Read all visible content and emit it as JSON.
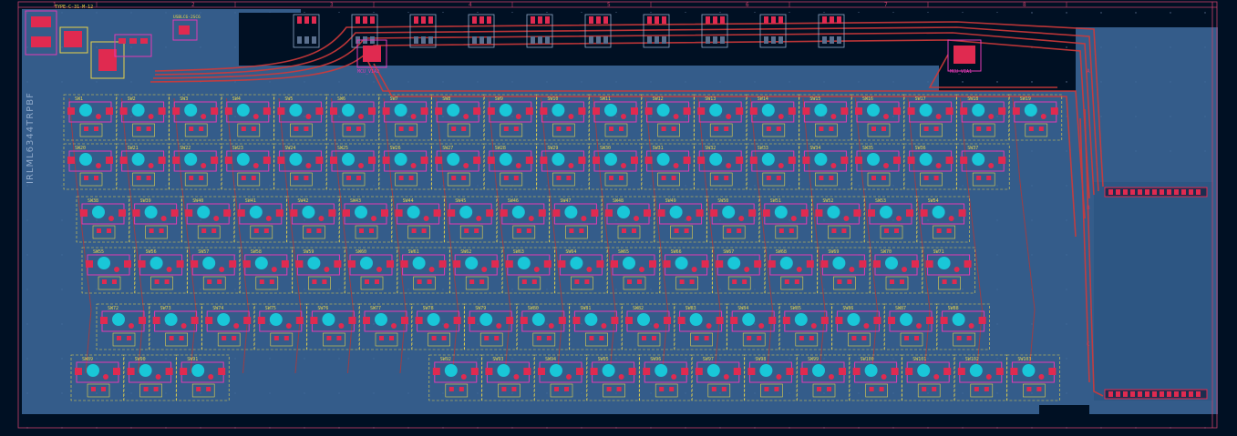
{
  "board": {
    "ruler_numbers": [
      "1",
      "2",
      "3",
      "4",
      "5",
      "6",
      "7",
      "8"
    ],
    "ruler_letters": [
      "A",
      "B",
      "C"
    ],
    "side_label": "IRLML6344TRPBF",
    "top_labels": [
      "TYPE-C-31-M-12",
      "USBLC6-2SC6"
    ],
    "mcu_labels": [
      "MCU_VIA2",
      "MCU_VIA1"
    ],
    "colors": {
      "background": "#001023",
      "copper_fill": "#3d6a9c",
      "trace_red": "#d03a3a",
      "silk_yellow": "#e7d24a",
      "courtyard_pink": "#e23ab4",
      "pad_red": "#e02a50",
      "hole_cyan": "#19c7d8"
    }
  },
  "rows": [
    {
      "labels": [
        "SW1",
        "SW2",
        "SW3",
        "SW4",
        "SW5",
        "SW6",
        "SW7",
        "SW8",
        "SW9",
        "SW10",
        "SW11",
        "SW12",
        "SW13",
        "SW14",
        "SW15",
        "SW16",
        "SW17",
        "SW18",
        "SW19"
      ]
    },
    {
      "labels": [
        "SW20",
        "SW21",
        "SW22",
        "SW23",
        "SW24",
        "SW25",
        "SW26",
        "SW27",
        "SW28",
        "SW29",
        "SW30",
        "SW31",
        "SW32",
        "SW33",
        "SW34",
        "SW35",
        "SW36",
        "SW37"
      ]
    },
    {
      "labels": [
        "SW38",
        "SW39",
        "SW40",
        "SW41",
        "SW42",
        "SW43",
        "SW44",
        "SW45",
        "SW46",
        "SW47",
        "SW48",
        "SW49",
        "SW50",
        "SW51",
        "SW52",
        "SW53",
        "SW54"
      ]
    },
    {
      "labels": [
        "SW55",
        "SW56",
        "SW57",
        "SW58",
        "SW59",
        "SW60",
        "SW61",
        "SW62",
        "SW63",
        "SW64",
        "SW65",
        "SW66",
        "SW67",
        "SW68",
        "SW69",
        "SW70",
        "SW71"
      ]
    },
    {
      "labels": [
        "SW72",
        "SW73",
        "SW74",
        "SW75",
        "SW76",
        "SW77",
        "SW78",
        "SW79",
        "SW80",
        "SW81",
        "SW82",
        "SW83",
        "SW84",
        "SW85",
        "SW86",
        "SW87",
        "SW88"
      ]
    },
    {
      "labels": [
        "SW89",
        "SW90",
        "SW91",
        "SW92",
        "SW93",
        "SW94",
        "SW95",
        "SW96",
        "SW97",
        "SW98",
        "SW99",
        "SW100",
        "SW101",
        "SW102",
        "SW103"
      ]
    }
  ]
}
